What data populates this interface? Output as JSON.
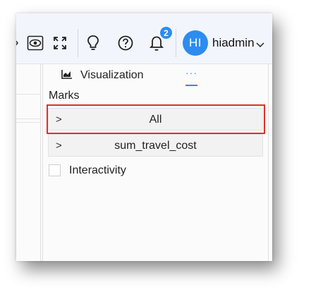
{
  "header": {
    "notification_count": "2",
    "user_initials": "HI",
    "username": "hiadmin",
    "accent_color": "#2d8cf0",
    "icons": [
      "chevron-icon",
      "eye-icon",
      "fullscreen-icon",
      "lightbulb-icon",
      "help-icon",
      "bell-icon",
      "dropdown-caret-icon"
    ]
  },
  "panel": {
    "tab_label": "Visualization",
    "more_label": "···",
    "marks_label": "Marks",
    "marks": [
      {
        "label": "All",
        "chevron": ">"
      },
      {
        "label": "sum_travel_cost",
        "chevron": ">"
      }
    ],
    "interactivity_label": "Interactivity",
    "highlight_color": "#e0302a"
  }
}
